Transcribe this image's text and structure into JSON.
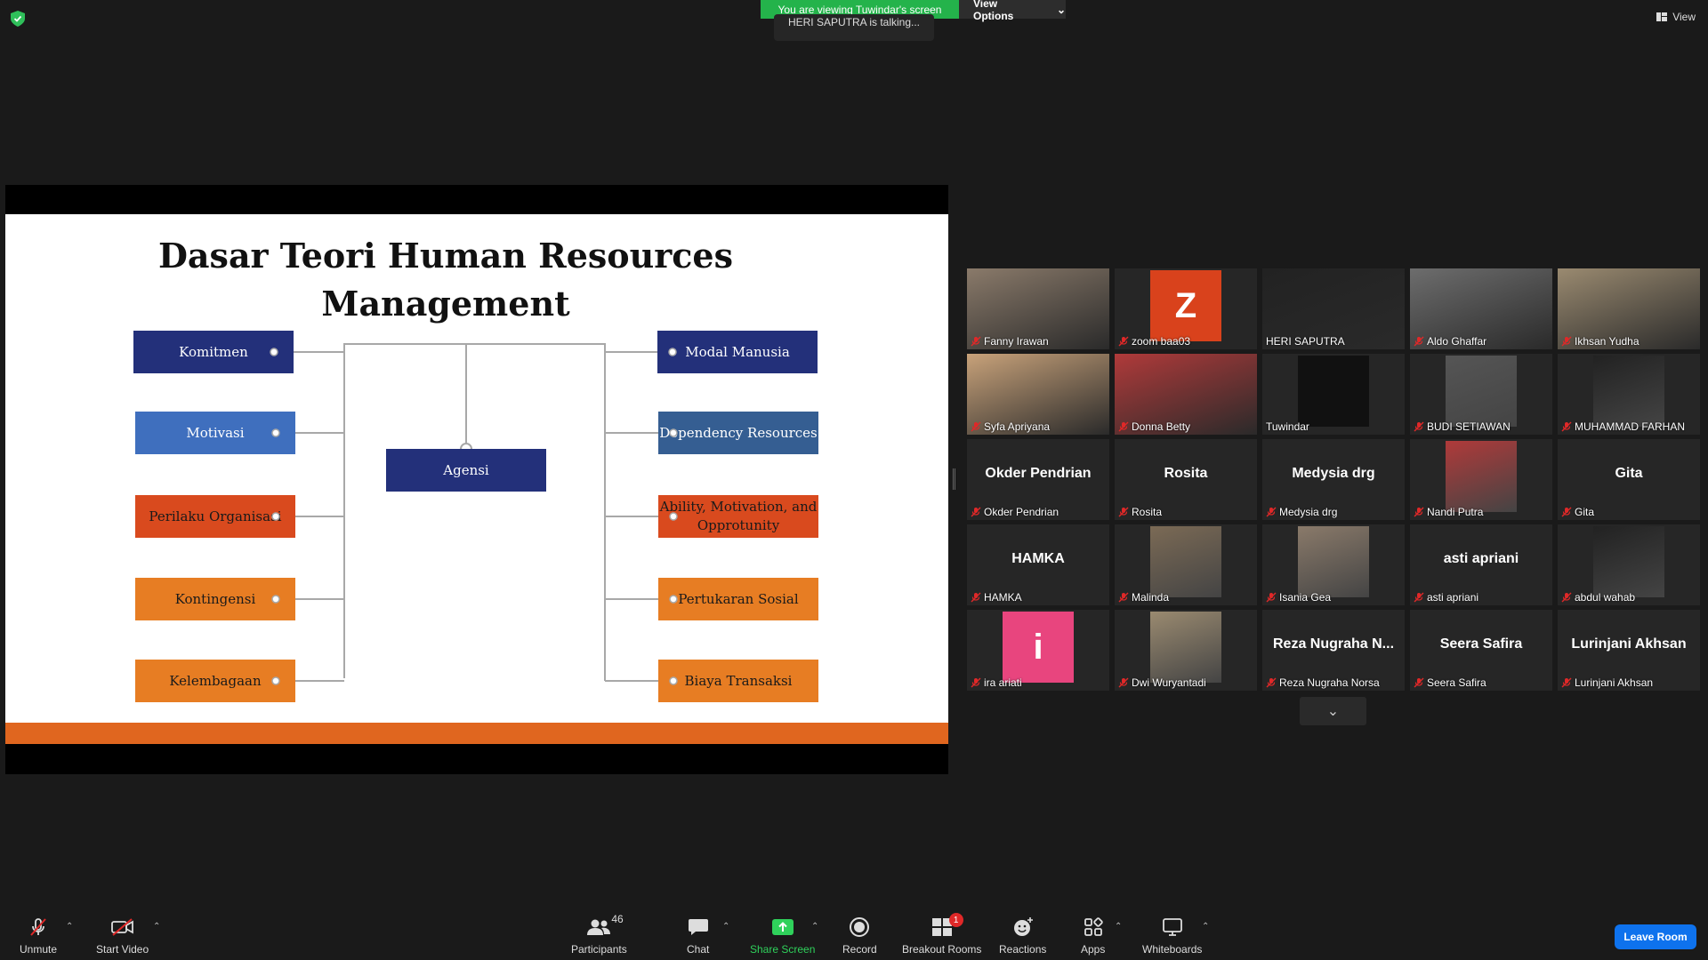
{
  "top": {
    "viewing_banner": "You are viewing Tuwindar's screen",
    "view_options": "View Options",
    "talking": "HERI SAPUTRA is talking...",
    "view": "View"
  },
  "slide": {
    "title_line1": "Dasar Teori Human Resources",
    "title_line2": "Management",
    "center": "Agensi",
    "left": [
      "Komitmen",
      "Motivasi",
      "Perilaku Organisasi",
      "Kontingensi",
      "Kelembagaan"
    ],
    "right": [
      "Modal Manusia",
      "Dependency Resources",
      "Ability, Motivation, and Opprotunity",
      "Pertukaran Sosial",
      "Biaya Transaksi"
    ],
    "colors": {
      "navy": "#23307a",
      "blue": "#3f6fbe",
      "steel": "#355e92",
      "red": "#d94a1e",
      "orange": "#e77d23"
    }
  },
  "participants": [
    {
      "name": "Fanny Irawan",
      "type": "video",
      "muted": true
    },
    {
      "name": "zoom baa03",
      "type": "avatar",
      "letter": "Z",
      "color": "#d9421c",
      "muted": true
    },
    {
      "name": "HERI SAPUTRA",
      "type": "video",
      "muted": false,
      "active": true
    },
    {
      "name": "Aldo Ghaffar",
      "type": "video",
      "muted": true
    },
    {
      "name": "Ikhsan Yudha",
      "type": "video",
      "muted": true
    },
    {
      "name": "Syfa Apriyana",
      "type": "video",
      "muted": true
    },
    {
      "name": "Donna Betty",
      "type": "video",
      "muted": true
    },
    {
      "name": "Tuwindar",
      "type": "dark",
      "muted": false
    },
    {
      "name": "BUDI SETIAWAN",
      "type": "photo",
      "muted": true
    },
    {
      "name": "MUHAMMAD FARHAN",
      "type": "photo",
      "muted": true
    },
    {
      "name": "Okder Pendrian",
      "type": "text",
      "muted": true
    },
    {
      "name": "Rosita",
      "type": "text",
      "muted": true
    },
    {
      "name": "Medysia drg",
      "type": "text",
      "muted": true
    },
    {
      "name": "Nandi Putra",
      "type": "photo",
      "muted": true
    },
    {
      "name": "Gita",
      "type": "text",
      "muted": true
    },
    {
      "name": "HAMKA",
      "type": "text",
      "muted": true
    },
    {
      "name": "Malinda",
      "type": "photo",
      "muted": true
    },
    {
      "name": "Isania Gea",
      "type": "photo",
      "muted": true
    },
    {
      "name": "asti apriani",
      "type": "text",
      "muted": true
    },
    {
      "name": "abdul wahab",
      "type": "photo",
      "muted": true
    },
    {
      "name": "ira ariati",
      "type": "avatar",
      "letter": "i",
      "color": "#e8457e",
      "muted": true
    },
    {
      "name": "Dwi Wuryantadi",
      "type": "photo",
      "muted": true
    },
    {
      "name": "Reza Nugraha Norsa",
      "type": "text",
      "big": "Reza Nugraha N...",
      "muted": true
    },
    {
      "name": "Seera Safira",
      "type": "text",
      "muted": true
    },
    {
      "name": "Lurinjani Akhsan",
      "type": "text",
      "muted": true
    }
  ],
  "toolbar": {
    "unmute": "Unmute",
    "start_video": "Start Video",
    "participants": "Participants",
    "participants_count": "46",
    "chat": "Chat",
    "share_screen": "Share Screen",
    "record": "Record",
    "breakout_rooms": "Breakout Rooms",
    "breakout_badge": "1",
    "reactions": "Reactions",
    "apps": "Apps",
    "whiteboards": "Whiteboards",
    "leave_room": "Leave Room"
  }
}
